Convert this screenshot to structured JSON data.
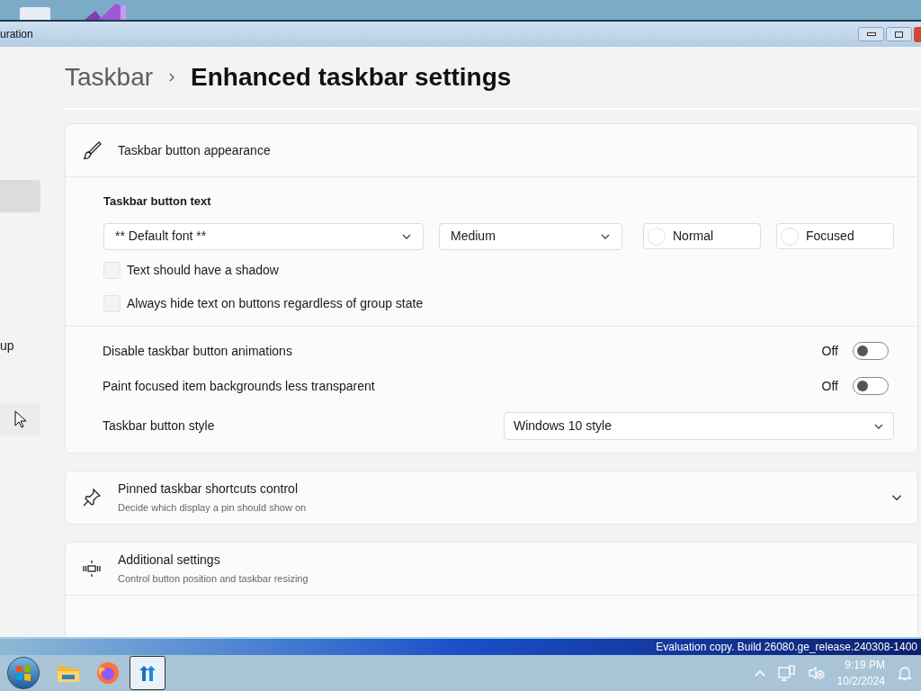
{
  "window": {
    "title": "uration"
  },
  "sidebar": {
    "items": [
      {
        "selected": true
      },
      {
        "label": "up",
        "selected": false
      },
      {
        "selected": false,
        "hovered": true
      }
    ]
  },
  "breadcrumb": [
    "Taskbar",
    "Enhanced taskbar settings"
  ],
  "sections": [
    {
      "kind": "brush",
      "title": "Taskbar button appearance",
      "expanded": true,
      "subheading": "Taskbar button text",
      "dropdowns": [
        "** Default font **",
        "Medium"
      ],
      "color_buttons": [
        {
          "label": "Normal",
          "color": "#ffffff"
        },
        {
          "label": "Focused",
          "color": "#ffffff"
        }
      ],
      "checkboxes": [
        {
          "label": "Text should have a shadow",
          "checked": false
        },
        {
          "label": "Always hide text on buttons regardless of group state",
          "checked": false
        }
      ],
      "rows": [
        {
          "kind": "toggle",
          "label": "Disable taskbar button animations",
          "state": "Off",
          "on": false
        },
        {
          "kind": "toggle",
          "label": "Paint focused item backgrounds less transparent",
          "state": "Off",
          "on": false
        },
        {
          "kind": "select",
          "label": "Taskbar button style",
          "value": "Windows 10 style"
        }
      ]
    },
    {
      "kind": "pin",
      "title": "Pinned taskbar shortcuts control",
      "subtitle": "Decide which display a pin should show on",
      "expanded": false
    },
    {
      "kind": "resize",
      "title": "Additional settings",
      "subtitle": "Control button position and taskbar resizing",
      "expanded": true
    }
  ],
  "watermark": "Evaluation copy. Build 26080.ge_release.240308-1400",
  "taskbar": {
    "apps": [
      {
        "kind": "folder",
        "active": false
      },
      {
        "kind": "browser",
        "active": false
      },
      {
        "kind": "app",
        "active": true
      }
    ],
    "clock": {
      "time": "9:19 PM",
      "date": "10/2/2024"
    }
  }
}
